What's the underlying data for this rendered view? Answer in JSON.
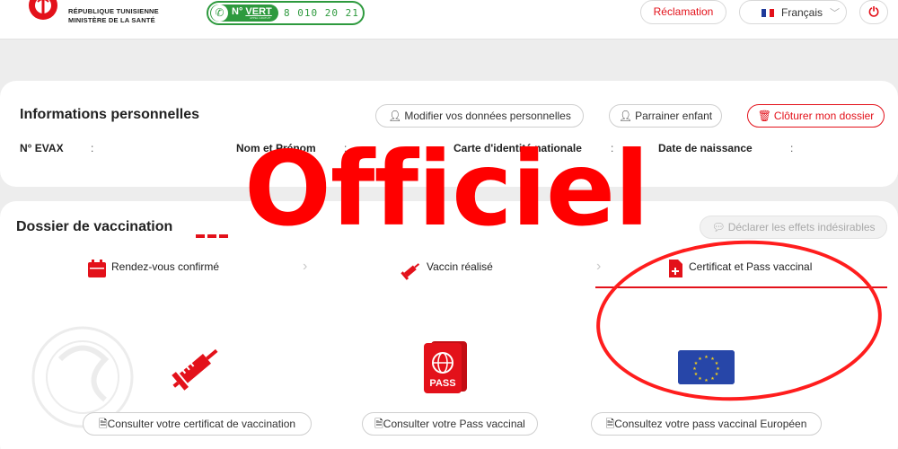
{
  "header": {
    "ministry_line1": "RÉPUBLIQUE TUNISIENNE",
    "ministry_line2": "MINISTÈRE DE LA SANTÉ",
    "hotline_label_n": "N°",
    "hotline_label_vert": "VERT",
    "hotline_sub": "APPEL GRATUIT",
    "hotline_number": "8 010 20 21",
    "reclamation": "Réclamation",
    "language": "Français",
    "colors": {
      "accent": "#e3111a",
      "green": "#2e9a3e"
    }
  },
  "personal_info": {
    "title": "Informations personnelles",
    "buttons": {
      "modify": "Modifier vos données personnelles",
      "sponsor": "Parrainer enfant",
      "close": "Clôturer mon dossier"
    },
    "fields": {
      "evax": "N° EVAX",
      "name": "Nom et Prénom",
      "id_card": "Carte d'identité nationale",
      "birth": "Date de naissance",
      "separator": ":"
    }
  },
  "vaccination": {
    "title": "Dossier de vaccination",
    "declare_button": "Déclarer les effets indésirables",
    "steps": [
      {
        "label": "Rendez-vous confirmé",
        "icon": "calendar-icon"
      },
      {
        "label": "Vaccin réalisé",
        "icon": "syringe-icon"
      },
      {
        "label": "Certificat et Pass vaccinal",
        "icon": "document-plus-icon"
      }
    ],
    "pass_badge": "PASS",
    "actions": {
      "certificate": "Consulter votre certificat de vaccination",
      "pass": "Consulter votre Pass vaccinal",
      "eu_pass": "Consultez votre pass vaccinal Européen"
    }
  },
  "overlay": {
    "watermark": "Officiel"
  }
}
